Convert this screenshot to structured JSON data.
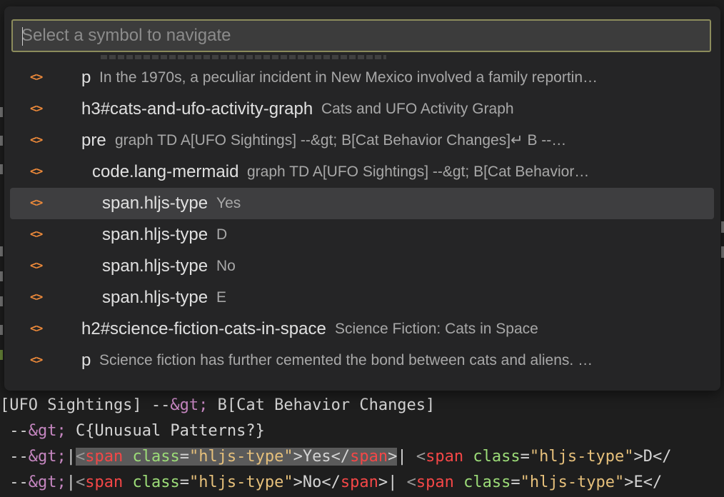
{
  "quick_pick": {
    "placeholder": "Select a symbol to navigate",
    "items": [
      {
        "icon": "symbol-tag-icon",
        "label": "p",
        "description": "In the 1970s, a peculiar incident in New Mexico involved a family reportin…",
        "indent": 0
      },
      {
        "icon": "symbol-tag-icon",
        "label": "h3#cats-and-ufo-activity-graph",
        "description": "Cats and UFO Activity Graph",
        "indent": 0
      },
      {
        "icon": "symbol-tag-icon",
        "label": "pre",
        "description": "graph TD    A[UFO Sightings] --&gt; B[Cat Behavior Changes]↵    B --…",
        "indent": 0
      },
      {
        "icon": "symbol-tag-icon",
        "label": "code.lang-mermaid",
        "description": "graph TD    A[UFO Sightings] --&gt; B[Cat Behavior…",
        "indent": 1
      },
      {
        "icon": "symbol-tag-icon",
        "label": "span.hljs-type",
        "description": "Yes",
        "indent": 2,
        "selected": true
      },
      {
        "icon": "symbol-tag-icon",
        "label": "span.hljs-type",
        "description": "D",
        "indent": 2
      },
      {
        "icon": "symbol-tag-icon",
        "label": "span.hljs-type",
        "description": "No",
        "indent": 2
      },
      {
        "icon": "symbol-tag-icon",
        "label": "span.hljs-type",
        "description": "E",
        "indent": 2
      },
      {
        "icon": "symbol-tag-icon",
        "label": "h2#science-fiction-cats-in-space",
        "description": "Science Fiction: Cats in Space",
        "indent": 0
      },
      {
        "icon": "symbol-tag-icon",
        "label": "p",
        "description": "Science fiction has further cemented the bond between cats and aliens. …",
        "indent": 0
      }
    ]
  },
  "editor": {
    "lines": [
      [
        {
          "t": "[UFO Sightings] --",
          "c": "tok-punc"
        },
        {
          "t": "&gt;",
          "c": "tok-ent"
        },
        {
          "t": " B[Cat Behavior Changes]",
          "c": "tok-punc"
        }
      ],
      [
        {
          "t": " --",
          "c": "tok-punc"
        },
        {
          "t": "&gt;",
          "c": "tok-ent"
        },
        {
          "t": " C{Unusual Patterns?}",
          "c": "tok-punc"
        }
      ],
      [
        {
          "t": " --",
          "c": "tok-punc"
        },
        {
          "t": "&gt;",
          "c": "tok-ent"
        },
        {
          "t": "|",
          "c": "tok-punc"
        },
        {
          "t": "<",
          "c": "tok-angle tok-hl"
        },
        {
          "t": "span",
          "c": "tok-tag tok-hl"
        },
        {
          "t": " ",
          "c": "tok-punc tok-hl"
        },
        {
          "t": "class",
          "c": "tok-attr tok-hl"
        },
        {
          "t": "=",
          "c": "tok-punc tok-hl"
        },
        {
          "t": "\"hljs-type\"",
          "c": "tok-str tok-hl"
        },
        {
          "t": ">Yes</",
          "c": "tok-punc tok-hl"
        },
        {
          "t": "span",
          "c": "tok-tag tok-hl"
        },
        {
          "t": ">",
          "c": "tok-punc tok-hl"
        },
        {
          "t": "| ",
          "c": "tok-punc"
        },
        {
          "t": "<",
          "c": "tok-angle"
        },
        {
          "t": "span",
          "c": "tok-tag"
        },
        {
          "t": " ",
          "c": "tok-punc"
        },
        {
          "t": "class",
          "c": "tok-attr"
        },
        {
          "t": "=",
          "c": "tok-punc"
        },
        {
          "t": "\"hljs-type\"",
          "c": "tok-str"
        },
        {
          "t": ">D</",
          "c": "tok-punc"
        }
      ],
      [
        {
          "t": " --",
          "c": "tok-punc"
        },
        {
          "t": "&gt;",
          "c": "tok-ent"
        },
        {
          "t": "|",
          "c": "tok-punc"
        },
        {
          "t": "<",
          "c": "tok-angle"
        },
        {
          "t": "span",
          "c": "tok-tag"
        },
        {
          "t": " ",
          "c": "tok-punc"
        },
        {
          "t": "class",
          "c": "tok-attr"
        },
        {
          "t": "=",
          "c": "tok-punc"
        },
        {
          "t": "\"hljs-type\"",
          "c": "tok-str"
        },
        {
          "t": ">No</",
          "c": "tok-punc"
        },
        {
          "t": "span",
          "c": "tok-tag"
        },
        {
          "t": ">",
          "c": "tok-punc"
        },
        {
          "t": "| ",
          "c": "tok-punc"
        },
        {
          "t": "<",
          "c": "tok-angle"
        },
        {
          "t": "span",
          "c": "tok-tag"
        },
        {
          "t": " ",
          "c": "tok-punc"
        },
        {
          "t": "class",
          "c": "tok-attr"
        },
        {
          "t": "=",
          "c": "tok-punc"
        },
        {
          "t": "\"hljs-type\"",
          "c": "tok-str"
        },
        {
          "t": ">E</",
          "c": "tok-punc"
        }
      ]
    ]
  },
  "colors": {
    "icon_accent": "#ee8a3a",
    "selection": "#3e3e40",
    "input_border": "#8c8c5c"
  }
}
